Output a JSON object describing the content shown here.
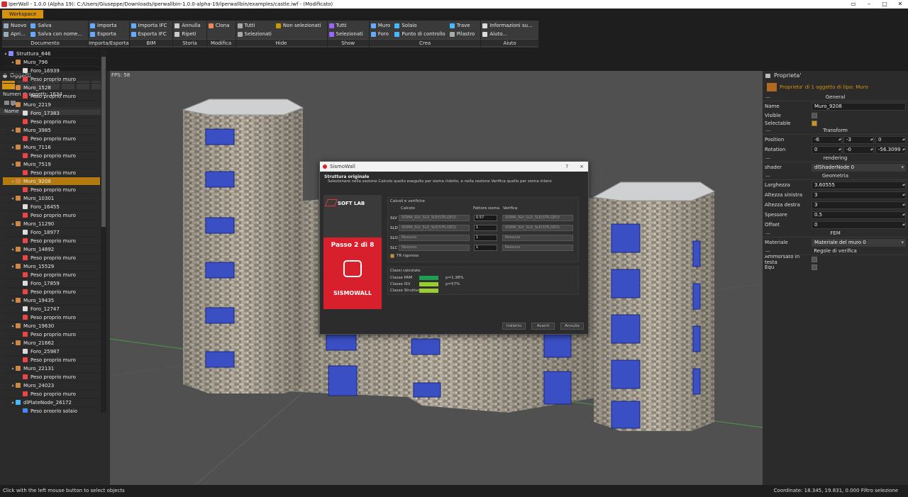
{
  "window": {
    "title": "IperWall - 1.0.0 (Alpha 19): C:/Users/Giuseppe/Downloads/iperwallbin-1.0.0-alpha-19/iperwallbin/examples/castle.iwf  - (Modificato)"
  },
  "menubar": {
    "workspace": "Workspace"
  },
  "ribbon": [
    {
      "label": "Documento",
      "cols": [
        [
          {
            "t": "Nuovo",
            "c": "#9ab"
          },
          {
            "t": "Apri...",
            "c": "#9ab"
          }
        ],
        [
          {
            "t": "Salva",
            "c": "#6af"
          },
          {
            "t": "Salva con nome...",
            "c": "#6af"
          }
        ]
      ]
    },
    {
      "label": "Importa/Esporta",
      "cols": [
        [
          {
            "t": "Importa",
            "c": "#6af"
          },
          {
            "t": "Esporta",
            "c": "#6af"
          }
        ]
      ]
    },
    {
      "label": "BIM",
      "cols": [
        [
          {
            "t": "Importa IFC",
            "c": "#6af"
          },
          {
            "t": "Esporta IFC",
            "c": "#6af"
          }
        ]
      ]
    },
    {
      "label": "Storia",
      "cols": [
        [
          {
            "t": "Annulla",
            "c": "#ccc"
          },
          {
            "t": "Ripeti",
            "c": "#ccc"
          }
        ]
      ]
    },
    {
      "label": "Modifica",
      "cols": [
        [
          {
            "t": "Clona",
            "c": "#e85"
          }
        ]
      ]
    },
    {
      "label": "Hide",
      "cols": [
        [
          {
            "t": "Tutti",
            "c": "#aaa"
          },
          {
            "t": "Selezionati",
            "c": "#aaa"
          }
        ],
        [
          {
            "t": "Non selezionati",
            "c": "#c90"
          }
        ]
      ]
    },
    {
      "label": "Show",
      "cols": [
        [
          {
            "t": "Tutti",
            "c": "#96f"
          },
          {
            "t": "Selezionati",
            "c": "#96f"
          }
        ]
      ]
    },
    {
      "label": "Crea",
      "cols": [
        [
          {
            "t": "Muro",
            "c": "#6af"
          },
          {
            "t": "Foro",
            "c": "#6af"
          }
        ],
        [
          {
            "t": "Solaio",
            "c": "#4bf"
          },
          {
            "t": "Punto di controllo",
            "c": "#4bf"
          }
        ],
        [
          {
            "t": "Trave",
            "c": "#4bf"
          },
          {
            "t": "Pilastro",
            "c": "#aaa"
          }
        ]
      ]
    },
    {
      "label": "Aiuto",
      "cols": [
        [
          {
            "t": "Informazioni su...",
            "c": "#ddd"
          },
          {
            "t": "Aiuto...",
            "c": "#ddd"
          }
        ]
      ]
    }
  ],
  "objects_panel": {
    "title": "Oggetti",
    "count": "Numeri di oggetti: 1634",
    "column": "Name",
    "rows": [
      {
        "d": 0,
        "a": "▴",
        "t": "Struttura_646",
        "c": "#88f"
      },
      {
        "d": 1,
        "a": "▴",
        "t": "Muro_796",
        "c": "#c84"
      },
      {
        "d": 2,
        "a": "",
        "t": "Foro_16939",
        "c": "#ddd"
      },
      {
        "d": 2,
        "a": "",
        "t": "Peso proprio muro",
        "c": "#e44"
      },
      {
        "d": 1,
        "a": "▴",
        "t": "Muro_1528",
        "c": "#c84"
      },
      {
        "d": 2,
        "a": "",
        "t": "Peso proprio muro",
        "c": "#e44"
      },
      {
        "d": 1,
        "a": "▴",
        "t": "Muro_2219",
        "c": "#c84"
      },
      {
        "d": 2,
        "a": "",
        "t": "Foro_17383",
        "c": "#ddd"
      },
      {
        "d": 2,
        "a": "",
        "t": "Peso proprio muro",
        "c": "#e44"
      },
      {
        "d": 1,
        "a": "▴",
        "t": "Muro_3985",
        "c": "#c84"
      },
      {
        "d": 2,
        "a": "",
        "t": "Peso proprio muro",
        "c": "#e44"
      },
      {
        "d": 1,
        "a": "▴",
        "t": "Muro_7116",
        "c": "#c84"
      },
      {
        "d": 2,
        "a": "",
        "t": "Peso proprio muro",
        "c": "#e44"
      },
      {
        "d": 1,
        "a": "▴",
        "t": "Muro_7519",
        "c": "#c84"
      },
      {
        "d": 2,
        "a": "",
        "t": "Peso proprio muro",
        "c": "#e44"
      },
      {
        "d": 1,
        "a": "▴",
        "t": "Muro_9208",
        "c": "#c84",
        "sel": true
      },
      {
        "d": 2,
        "a": "",
        "t": "Peso proprio muro",
        "c": "#e44"
      },
      {
        "d": 1,
        "a": "▴",
        "t": "Muro_10301",
        "c": "#c84"
      },
      {
        "d": 2,
        "a": "",
        "t": "Foro_16455",
        "c": "#ddd"
      },
      {
        "d": 2,
        "a": "",
        "t": "Peso proprio muro",
        "c": "#e44"
      },
      {
        "d": 1,
        "a": "▴",
        "t": "Muro_11290",
        "c": "#c84"
      },
      {
        "d": 2,
        "a": "",
        "t": "Foro_18977",
        "c": "#ddd"
      },
      {
        "d": 2,
        "a": "",
        "t": "Peso proprio muro",
        "c": "#e44"
      },
      {
        "d": 1,
        "a": "▴",
        "t": "Muro_14892",
        "c": "#c84"
      },
      {
        "d": 2,
        "a": "",
        "t": "Peso proprio muro",
        "c": "#e44"
      },
      {
        "d": 1,
        "a": "▴",
        "t": "Muro_15529",
        "c": "#c84"
      },
      {
        "d": 2,
        "a": "",
        "t": "Peso proprio muro",
        "c": "#e44"
      },
      {
        "d": 2,
        "a": "",
        "t": "Foro_17859",
        "c": "#ddd"
      },
      {
        "d": 2,
        "a": "",
        "t": "Peso proprio muro",
        "c": "#e44"
      },
      {
        "d": 1,
        "a": "▴",
        "t": "Muro_19435",
        "c": "#c84"
      },
      {
        "d": 2,
        "a": "",
        "t": "Foro_12747",
        "c": "#ddd"
      },
      {
        "d": 2,
        "a": "",
        "t": "Peso proprio muro",
        "c": "#e44"
      },
      {
        "d": 1,
        "a": "▴",
        "t": "Muro_19630",
        "c": "#c84"
      },
      {
        "d": 2,
        "a": "",
        "t": "Peso proprio muro",
        "c": "#e44"
      },
      {
        "d": 1,
        "a": "▴",
        "t": "Muro_21662",
        "c": "#c84"
      },
      {
        "d": 2,
        "a": "",
        "t": "Foro_25987",
        "c": "#ddd"
      },
      {
        "d": 2,
        "a": "",
        "t": "Peso proprio muro",
        "c": "#e44"
      },
      {
        "d": 1,
        "a": "▴",
        "t": "Muro_22131",
        "c": "#c84"
      },
      {
        "d": 2,
        "a": "",
        "t": "Peso proprio muro",
        "c": "#e44"
      },
      {
        "d": 1,
        "a": "▴",
        "t": "Muro_24023",
        "c": "#c84"
      },
      {
        "d": 2,
        "a": "",
        "t": "Peso proprio muro",
        "c": "#e44"
      },
      {
        "d": 1,
        "a": "▴",
        "t": "dlPlateNode_26172",
        "c": "#4bf"
      },
      {
        "d": 2,
        "a": "",
        "t": "Peso proprio solaio",
        "c": "#48f"
      }
    ]
  },
  "viewport": {
    "fps": "FPS: 58"
  },
  "properties": {
    "title": "Proprieta'",
    "subtitle": "Proprieta' di 1 oggetto di tipo: Muro",
    "general": "General",
    "name_label": "Name",
    "name_value": "Muro_9208",
    "visible_label": "Visible",
    "selectable_label": "Selectable",
    "transform": "Transform",
    "position_label": "Position",
    "position": [
      "-6",
      "-3",
      "0"
    ],
    "rotation_label": "Rotation",
    "rotation": [
      "0",
      "-0",
      "-56.3099"
    ],
    "rendering": "rendering",
    "shader_label": "shader",
    "shader_value": "dlShaderNode 0",
    "geometria": "Geometria",
    "larghezza_label": "Larghezza",
    "larghezza": "3.60555",
    "altsx_label": "Altezza sinistra",
    "altsx": "3",
    "altdx_label": "Altezza destra",
    "altdx": "3",
    "spessore_label": "Spessore",
    "spessore": "0.5",
    "offset_label": "Offset",
    "offset": "0",
    "fem": "FEM",
    "materiale_label": "Materiale",
    "materiale_value": "Materiale del muro 0",
    "regole": "Regole di verifica",
    "ammorsato_label": "Ammorsato in testa",
    "equ_label": "Equ"
  },
  "dialog": {
    "title": "SismoWall",
    "help": "?",
    "close": "×",
    "heading": "Struttura originale",
    "subheading": "Selezionare nella sezione Calcolo quello eseguito per sisma ridotto, e nella sezione Verifica quello per sisma intero",
    "brand_top": "SOFT LAB",
    "step": "Passo 2 di 8",
    "brand_name": "SISMOWALL",
    "calc_box": "Calcoli e verifiche",
    "col_calcolo": "Calcolo",
    "col_fattore": "Fattore sisma",
    "col_verifica": "Verifica",
    "rows": [
      {
        "l": "SLV",
        "c": "SISMA_SLV_SLD_SLE(STR,GEO)",
        "f": "0.57",
        "v": "SISMA_SLV_SLD_SLE(STR,GEO)"
      },
      {
        "l": "SLD",
        "c": "SISMA_SLV_SLD_SLE(STR,GEO)",
        "f": "1",
        "v": "SISMA_SLV_SLD_SLE(STR,GEO)"
      },
      {
        "l": "SLO",
        "c": "Nessuno",
        "f": "1",
        "v": "Nessuno"
      },
      {
        "l": "SLC",
        "c": "Nessuno",
        "f": "1",
        "v": "Nessuno"
      }
    ],
    "tr_label": "TR rigoroso",
    "classi_box": "Classi calcolate",
    "classi": [
      {
        "l": "Classe PAM",
        "color": "#1aa050",
        "p": "p=1.38%"
      },
      {
        "l": "Classe ISV",
        "color": "#9acd32",
        "p": "p=57%"
      },
      {
        "l": "Classe Struttura",
        "color": "#9acd32",
        "p": ""
      }
    ],
    "btn_back": "Indietro",
    "btn_next": "Avanti",
    "btn_cancel": "Annulla"
  },
  "status": {
    "hint": "Click with the left mouse button to select objects",
    "coords": "Coordinate: 18.345, 19.831, 0.000  Filtro selezione"
  }
}
